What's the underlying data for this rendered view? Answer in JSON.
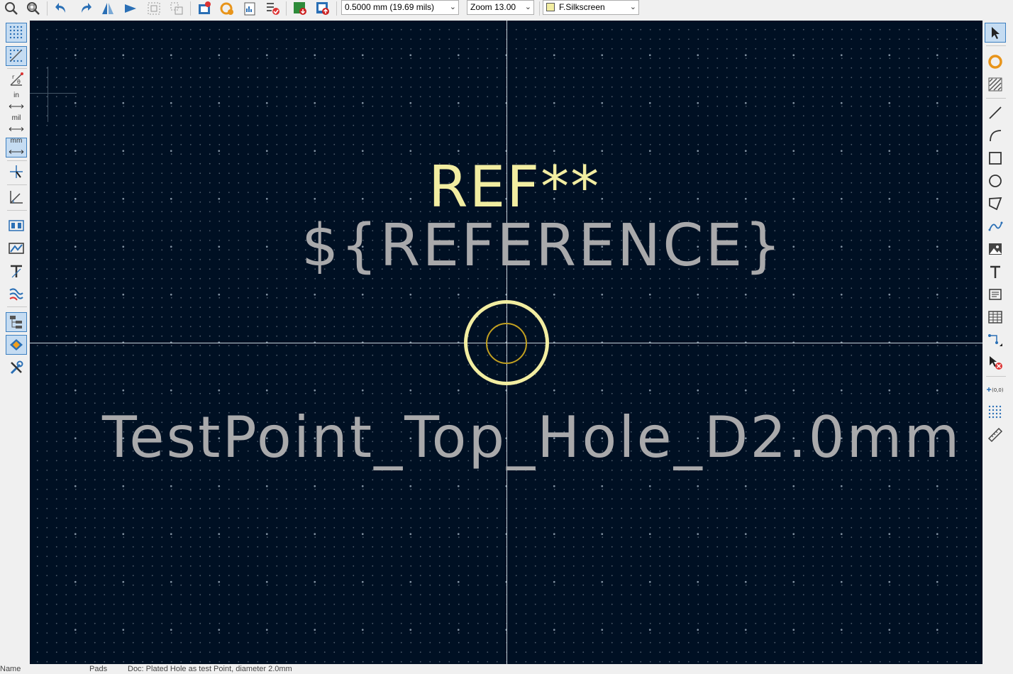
{
  "toolbar": {
    "grid_select": "0.5000 mm (19.69 mils)",
    "zoom_select": "Zoom 13.00",
    "layer_select": "F.Silkscreen",
    "layer_color": "#f2eda1"
  },
  "left_toolbar": {
    "unit_in": "in",
    "unit_mil": "mil",
    "unit_mm": "mm"
  },
  "canvas": {
    "reference_text": "REF**",
    "reference_var": "${REFERENCE}",
    "value_text": "TestPoint_Top_Hole_D2.0mm",
    "background_color": "#001023",
    "silkscreen_color": "#f2eda1",
    "fab_color": "#a9a9ab"
  },
  "status": {
    "name_label": "Name",
    "pads_label": "Pads",
    "doc_text": "Doc: Plated Hole as test Point, diameter 2.0mm"
  }
}
